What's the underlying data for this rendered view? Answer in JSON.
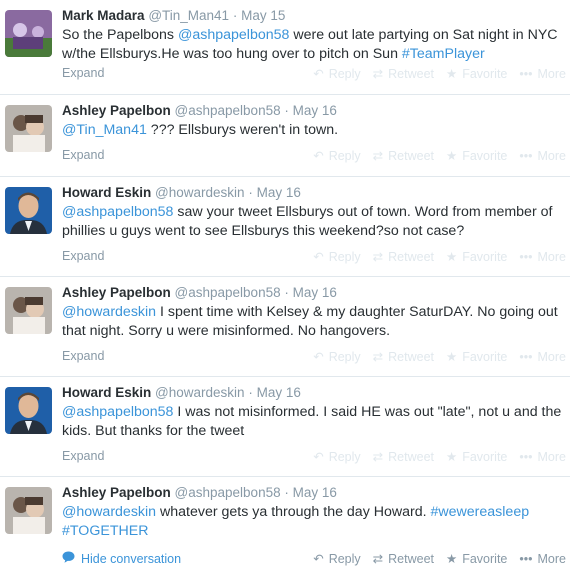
{
  "colors": {
    "link": "#3b94d9",
    "muted": "#8899a6",
    "faint": "#e1e8ed",
    "text": "#292f33"
  },
  "actions": {
    "reply": "Reply",
    "retweet": "Retweet",
    "favorite": "Favorite",
    "more": "More"
  },
  "expand_label": "Expand",
  "hide_conversation_label": "Hide conversation",
  "tweets": [
    {
      "fullname": "Mark Madara",
      "username": "@Tin_Man41",
      "sep": "·",
      "time": "May 15",
      "text": [
        {
          "t": "So the Papelbons ",
          "link": false
        },
        {
          "t": "@ashpapelbon58",
          "link": true
        },
        {
          "t": " were out late partying on Sat night in NYC w/the Ellsburys.He was too hung over to pitch on Sun ",
          "link": false
        },
        {
          "t": "#TeamPlayer",
          "link": true
        }
      ]
    },
    {
      "fullname": "Ashley Papelbon",
      "username": "@ashpapelbon58",
      "sep": "·",
      "time": "May 16",
      "text": [
        {
          "t": "@Tin_Man41",
          "link": true
        },
        {
          "t": " ??? Ellsburys weren't in town.",
          "link": false
        }
      ]
    },
    {
      "fullname": "Howard Eskin",
      "username": "@howardeskin",
      "sep": "·",
      "time": "May 16",
      "text": [
        {
          "t": "@ashpapelbon58",
          "link": true
        },
        {
          "t": " saw your tweet Ellsburys out of town. Word from member of phillies u guys went to see Ellsburys this weekend?so not case?",
          "link": false
        }
      ]
    },
    {
      "fullname": "Ashley Papelbon",
      "username": "@ashpapelbon58",
      "sep": "·",
      "time": "May 16",
      "text": [
        {
          "t": "@howardeskin",
          "link": true
        },
        {
          "t": " I spent time with Kelsey & my daughter SaturDAY. No going out that night. Sorry u were misinformed. No hangovers.",
          "link": false
        }
      ]
    },
    {
      "fullname": "Howard Eskin",
      "username": "@howardeskin",
      "sep": "·",
      "time": "May 16",
      "text": [
        {
          "t": "@ashpapelbon58",
          "link": true
        },
        {
          "t": " I was not misinformed. I said HE was out \"late\", not u and the kids. But thanks for the tweet",
          "link": false
        }
      ]
    },
    {
      "fullname": "Ashley Papelbon",
      "username": "@ashpapelbon58",
      "sep": "·",
      "time": "May 16",
      "text": [
        {
          "t": "@howardeskin",
          "link": true
        },
        {
          "t": " whatever gets ya through the day Howard. ",
          "link": false
        },
        {
          "t": "#wewereasleep",
          "link": true
        },
        {
          "t": " ",
          "link": false
        },
        {
          "t": "#TOGETHER",
          "link": true
        }
      ]
    }
  ]
}
